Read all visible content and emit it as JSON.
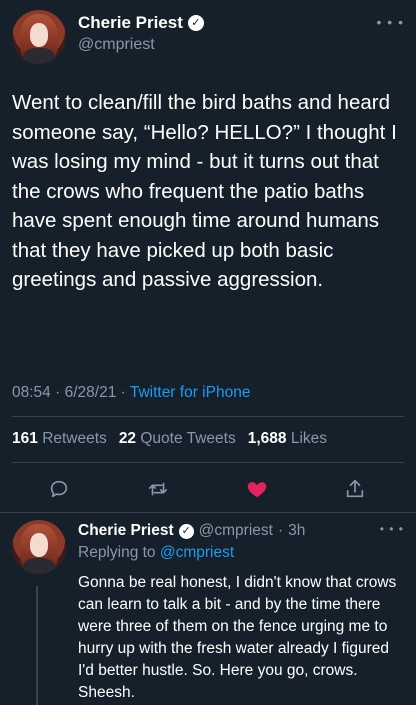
{
  "tweet": {
    "author_name": "Cherie Priest",
    "author_handle": "@cmpriest",
    "text": "Went to clean/fill the bird baths and heard someone say, “Hello? HELLO?” I thought I was losing my mind - but it turns out that the crows who frequent the patio baths have spent enough time around humans that they have picked up both basic greetings and passive aggression.",
    "time": "08:54",
    "date": "6/28/21",
    "source": "Twitter for iPhone",
    "retweets_count": "161",
    "retweets_label": "Retweets",
    "quote_count": "22",
    "quote_label": "Quote Tweets",
    "likes_count": "1,688",
    "likes_label": "Likes",
    "liked": true,
    "like_color": "#e0245e",
    "link_color": "#1d9bf0"
  },
  "reply": {
    "author_name": "Cherie Priest",
    "author_handle": "@cmpriest",
    "time_ago": "3h",
    "replying_prefix": "Replying to",
    "replying_handle": "@cmpriest",
    "text": "Gonna be real honest, I didn't know that crows can learn to talk a bit - and by the time there were three of them on the fence urging me to hurry up with the fresh water already I figured I'd better hustle. So. Here you go, crows. Sheesh."
  },
  "icons": {
    "verified": "verified-badge-icon",
    "more": "more-options-icon",
    "reply": "reply-icon",
    "retweet": "retweet-icon",
    "like": "heart-icon",
    "share": "share-icon"
  },
  "more_glyph": "• • •",
  "separator": "·"
}
